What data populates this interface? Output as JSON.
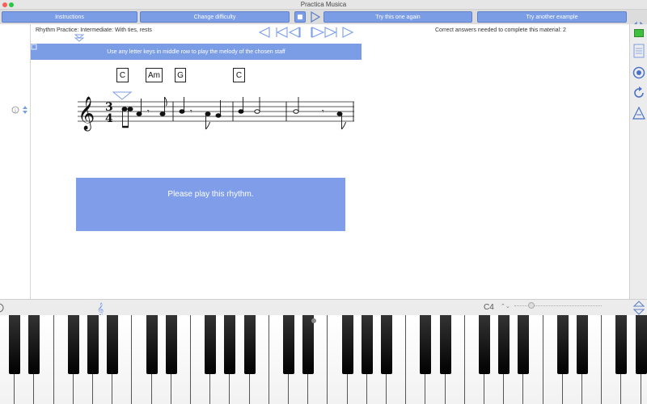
{
  "window": {
    "title": "Practica Musica"
  },
  "toolbar": {
    "instructions_label": "Instructions",
    "change_difficulty_label": "Change difficulty",
    "try_again_label": "Try this one again",
    "try_another_label": "Try another example",
    "accent_color": "#7b9de6"
  },
  "info": {
    "activity": "Rhythm Practice: Intermediate: With ties, rests",
    "requirement": "Correct answers needed to complete this material: 2"
  },
  "hint": {
    "text": "Use any letter keys in middle row to play the melody of the chosen staff"
  },
  "chords": [
    "C",
    "Am",
    "G",
    "C"
  ],
  "score": {
    "time_signature_top": "3",
    "time_signature_bottom": "4",
    "clef": "treble"
  },
  "prompt": {
    "text": "Please play this rhythm."
  },
  "bottom": {
    "note_label": "C4",
    "stepper": "⌃⌄"
  }
}
